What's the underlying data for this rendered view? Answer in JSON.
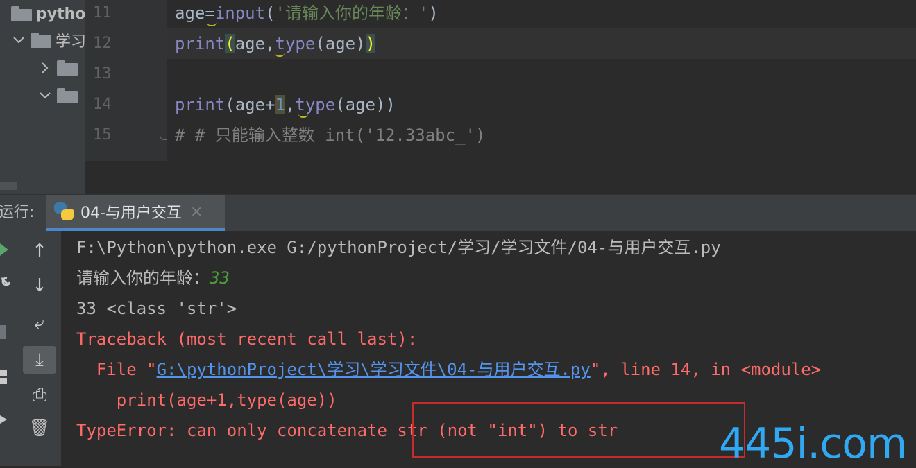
{
  "project_tree": {
    "root_label": "pytho",
    "child_label": "学习"
  },
  "editor": {
    "line_numbers": [
      "11",
      "12",
      "13",
      "14",
      "15"
    ],
    "line11": {
      "var": "age",
      "eq": "=",
      "fn": "input",
      "open": "(",
      "str": "'请输入你的年龄：'",
      "close": ")"
    },
    "line12": {
      "fn": "print",
      "open": "(",
      "a": "age",
      "comma": ",",
      "fn2": "type",
      "args": "(age)",
      "close": ")"
    },
    "line14": {
      "fn": "print",
      "a": "(age+",
      "num": "1",
      "comma": ",",
      "fn2": "type",
      "rest": "(age))"
    },
    "line15": {
      "comment": "# # 只能输入整数 int('12.33abc_')"
    }
  },
  "run_panel": {
    "title": "运行:",
    "tab_label": "04-与用户交互",
    "tab_close": "×"
  },
  "toolbar": {
    "up": "↑",
    "down": "↓",
    "wrap": "⤶",
    "scroll_end": "⤓",
    "print": "⎙",
    "trash": "🗑"
  },
  "console": {
    "cmd": "F:\\Python\\python.exe G:/pythonProject/学习/学习文件/04-与用户交互.py",
    "prompt": "请输入你的年龄：",
    "prompt_input": "33",
    "result": "33 <class 'str'>",
    "traceback": "Traceback (most recent call last):",
    "file_prefix": "  File \"",
    "file_link": "G:\\pythonProject\\学习\\学习文件\\04-与用户交互.py",
    "file_suffix": "\", line 14, in <module>",
    "code": "    print(age+1,type(age))",
    "error": "TypeError: can only concatenate str (not \"int\") to str"
  },
  "watermark": "445i.com",
  "colors": {
    "background": "#2b2b2b",
    "error": "#ff6b68",
    "link": "#5394ec",
    "highlight_box": "#c82b2b",
    "watermark": "#31a8f2"
  }
}
